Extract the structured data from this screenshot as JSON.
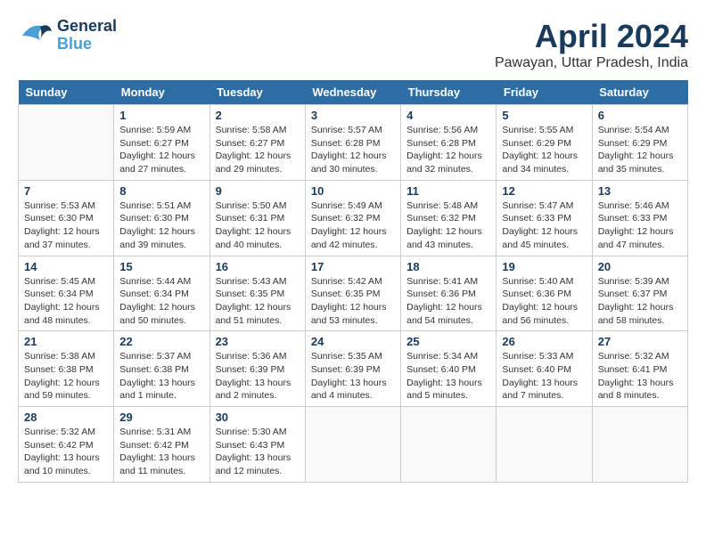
{
  "header": {
    "logo_general": "General",
    "logo_blue": "Blue",
    "title": "April 2024",
    "subtitle": "Pawayan, Uttar Pradesh, India"
  },
  "calendar": {
    "columns": [
      "Sunday",
      "Monday",
      "Tuesday",
      "Wednesday",
      "Thursday",
      "Friday",
      "Saturday"
    ],
    "weeks": [
      [
        {
          "day": null,
          "info": null
        },
        {
          "day": "1",
          "info": "Sunrise: 5:59 AM\nSunset: 6:27 PM\nDaylight: 12 hours\nand 27 minutes."
        },
        {
          "day": "2",
          "info": "Sunrise: 5:58 AM\nSunset: 6:27 PM\nDaylight: 12 hours\nand 29 minutes."
        },
        {
          "day": "3",
          "info": "Sunrise: 5:57 AM\nSunset: 6:28 PM\nDaylight: 12 hours\nand 30 minutes."
        },
        {
          "day": "4",
          "info": "Sunrise: 5:56 AM\nSunset: 6:28 PM\nDaylight: 12 hours\nand 32 minutes."
        },
        {
          "day": "5",
          "info": "Sunrise: 5:55 AM\nSunset: 6:29 PM\nDaylight: 12 hours\nand 34 minutes."
        },
        {
          "day": "6",
          "info": "Sunrise: 5:54 AM\nSunset: 6:29 PM\nDaylight: 12 hours\nand 35 minutes."
        }
      ],
      [
        {
          "day": "7",
          "info": "Sunrise: 5:53 AM\nSunset: 6:30 PM\nDaylight: 12 hours\nand 37 minutes."
        },
        {
          "day": "8",
          "info": "Sunrise: 5:51 AM\nSunset: 6:30 PM\nDaylight: 12 hours\nand 39 minutes."
        },
        {
          "day": "9",
          "info": "Sunrise: 5:50 AM\nSunset: 6:31 PM\nDaylight: 12 hours\nand 40 minutes."
        },
        {
          "day": "10",
          "info": "Sunrise: 5:49 AM\nSunset: 6:32 PM\nDaylight: 12 hours\nand 42 minutes."
        },
        {
          "day": "11",
          "info": "Sunrise: 5:48 AM\nSunset: 6:32 PM\nDaylight: 12 hours\nand 43 minutes."
        },
        {
          "day": "12",
          "info": "Sunrise: 5:47 AM\nSunset: 6:33 PM\nDaylight: 12 hours\nand 45 minutes."
        },
        {
          "day": "13",
          "info": "Sunrise: 5:46 AM\nSunset: 6:33 PM\nDaylight: 12 hours\nand 47 minutes."
        }
      ],
      [
        {
          "day": "14",
          "info": "Sunrise: 5:45 AM\nSunset: 6:34 PM\nDaylight: 12 hours\nand 48 minutes."
        },
        {
          "day": "15",
          "info": "Sunrise: 5:44 AM\nSunset: 6:34 PM\nDaylight: 12 hours\nand 50 minutes."
        },
        {
          "day": "16",
          "info": "Sunrise: 5:43 AM\nSunset: 6:35 PM\nDaylight: 12 hours\nand 51 minutes."
        },
        {
          "day": "17",
          "info": "Sunrise: 5:42 AM\nSunset: 6:35 PM\nDaylight: 12 hours\nand 53 minutes."
        },
        {
          "day": "18",
          "info": "Sunrise: 5:41 AM\nSunset: 6:36 PM\nDaylight: 12 hours\nand 54 minutes."
        },
        {
          "day": "19",
          "info": "Sunrise: 5:40 AM\nSunset: 6:36 PM\nDaylight: 12 hours\nand 56 minutes."
        },
        {
          "day": "20",
          "info": "Sunrise: 5:39 AM\nSunset: 6:37 PM\nDaylight: 12 hours\nand 58 minutes."
        }
      ],
      [
        {
          "day": "21",
          "info": "Sunrise: 5:38 AM\nSunset: 6:38 PM\nDaylight: 12 hours\nand 59 minutes."
        },
        {
          "day": "22",
          "info": "Sunrise: 5:37 AM\nSunset: 6:38 PM\nDaylight: 13 hours\nand 1 minute."
        },
        {
          "day": "23",
          "info": "Sunrise: 5:36 AM\nSunset: 6:39 PM\nDaylight: 13 hours\nand 2 minutes."
        },
        {
          "day": "24",
          "info": "Sunrise: 5:35 AM\nSunset: 6:39 PM\nDaylight: 13 hours\nand 4 minutes."
        },
        {
          "day": "25",
          "info": "Sunrise: 5:34 AM\nSunset: 6:40 PM\nDaylight: 13 hours\nand 5 minutes."
        },
        {
          "day": "26",
          "info": "Sunrise: 5:33 AM\nSunset: 6:40 PM\nDaylight: 13 hours\nand 7 minutes."
        },
        {
          "day": "27",
          "info": "Sunrise: 5:32 AM\nSunset: 6:41 PM\nDaylight: 13 hours\nand 8 minutes."
        }
      ],
      [
        {
          "day": "28",
          "info": "Sunrise: 5:32 AM\nSunset: 6:42 PM\nDaylight: 13 hours\nand 10 minutes."
        },
        {
          "day": "29",
          "info": "Sunrise: 5:31 AM\nSunset: 6:42 PM\nDaylight: 13 hours\nand 11 minutes."
        },
        {
          "day": "30",
          "info": "Sunrise: 5:30 AM\nSunset: 6:43 PM\nDaylight: 13 hours\nand 12 minutes."
        },
        {
          "day": null,
          "info": null
        },
        {
          "day": null,
          "info": null
        },
        {
          "day": null,
          "info": null
        },
        {
          "day": null,
          "info": null
        }
      ]
    ]
  }
}
